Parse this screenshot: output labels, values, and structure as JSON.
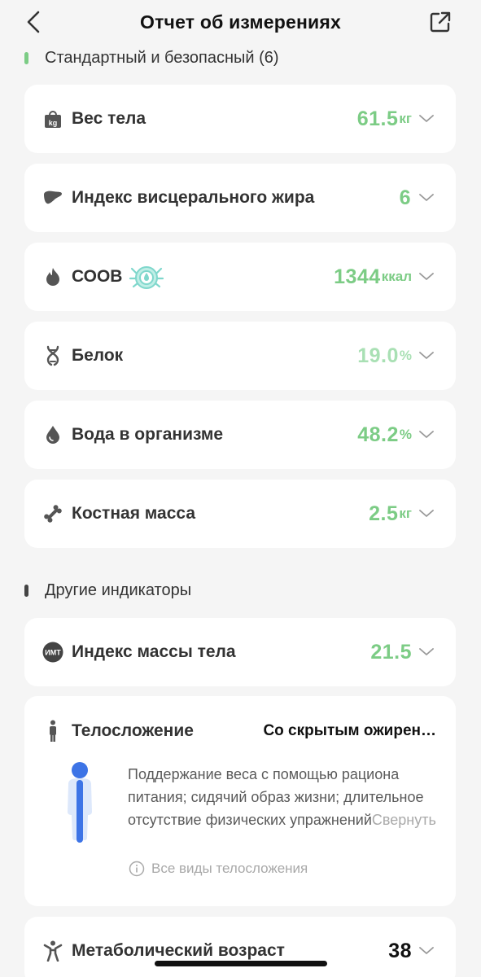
{
  "header": {
    "title": "Отчет об измерениях"
  },
  "colors": {
    "accent_green": "#7ccc85",
    "light_green": "#a9e0b4",
    "section_bar_green": "#7ccc85",
    "section_bar_dark": "#444444"
  },
  "sections": {
    "standard": {
      "label": "Стандартный и безопасный (6)"
    },
    "other": {
      "label": "Другие индикаторы"
    }
  },
  "metrics": [
    {
      "name": "Вес тела",
      "value": "61.5",
      "unit": "кг",
      "icon": "weight-kg-icon"
    },
    {
      "name": "Индекс висцерального жира",
      "value": "6",
      "unit": "",
      "icon": "liver-icon"
    },
    {
      "name": "СООВ",
      "value": "1344",
      "unit": "ккал",
      "icon": "flame-icon",
      "badge": "badge-icon"
    },
    {
      "name": "Белок",
      "value": "19.0",
      "unit": "%",
      "icon": "dna-icon"
    },
    {
      "name": "Вода в организме",
      "value": "48.2",
      "unit": "%",
      "icon": "water-drop-icon"
    },
    {
      "name": "Костная масса",
      "value": "2.5",
      "unit": "кг",
      "icon": "bone-icon"
    }
  ],
  "other_metrics": {
    "bmi": {
      "name": "Индекс массы тела",
      "value": "21.5",
      "icon_text": "ИМТ"
    },
    "body_type": {
      "name": "Телосложение",
      "value": "Со скрытым ожирен…",
      "description": "Поддержание веса с помощью рациона питания; сидячий образ жизни; длительное отсутствие физических упражнений",
      "collapse": "Свернуть",
      "all_types": "Все виды телосложения"
    },
    "metabolic_age": {
      "name": "Метаболический возраст",
      "value": "38"
    }
  }
}
